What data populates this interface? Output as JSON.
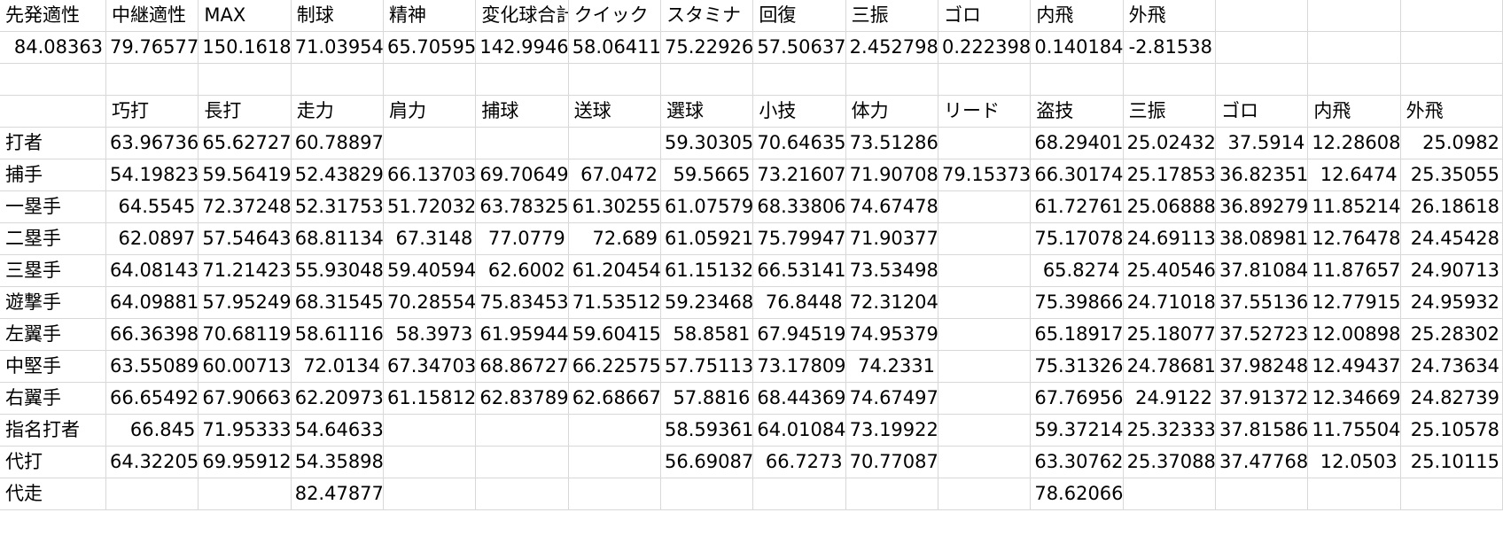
{
  "sheet": {
    "row1": [
      "先発適性",
      "中継適性",
      "MAX",
      "制球",
      "精神",
      "変化球合計",
      "クイック",
      "スタミナ",
      "回復",
      "三振",
      "ゴロ",
      "内飛",
      "外飛",
      "",
      "",
      ""
    ],
    "row2": [
      "84.08363",
      "79.76577",
      "150.1618",
      "71.03954",
      "65.70595",
      "142.9946",
      "58.06411",
      "75.22926",
      "57.50637",
      "2.452798",
      "0.222398",
      "0.140184",
      "-2.81538",
      "",
      "",
      ""
    ],
    "row3": [
      "",
      "",
      "",
      "",
      "",
      "",
      "",
      "",
      "",
      "",
      "",
      "",
      "",
      "",
      "",
      ""
    ],
    "row4": [
      "",
      "巧打",
      "長打",
      "走力",
      "肩力",
      "捕球",
      "送球",
      "選球",
      "小技",
      "体力",
      "リード",
      "盗技",
      "三振",
      "ゴロ",
      "内飛",
      "外飛"
    ],
    "rows": [
      [
        "打者",
        "63.96736",
        "65.62727",
        "60.78897",
        "",
        "",
        "",
        "59.30305",
        "70.64635",
        "73.51286",
        "",
        "68.29401",
        "25.02432",
        "37.5914",
        "12.28608",
        "25.0982"
      ],
      [
        "捕手",
        "54.19823",
        "59.56419",
        "52.43829",
        "66.13703",
        "69.70649",
        "67.0472",
        "59.5665",
        "73.21607",
        "71.90708",
        "79.15373",
        "66.30174",
        "25.17853",
        "36.82351",
        "12.6474",
        "25.35055"
      ],
      [
        "一塁手",
        "64.5545",
        "72.37248",
        "52.31753",
        "51.72032",
        "63.78325",
        "61.30255",
        "61.07579",
        "68.33806",
        "74.67478",
        "",
        "61.72761",
        "25.06888",
        "36.89279",
        "11.85214",
        "26.18618"
      ],
      [
        "二塁手",
        "62.0897",
        "57.54643",
        "68.81134",
        "67.3148",
        "77.0779",
        "72.689",
        "61.05921",
        "75.79947",
        "71.90377",
        "",
        "75.17078",
        "24.69113",
        "38.08981",
        "12.76478",
        "24.45428"
      ],
      [
        "三塁手",
        "64.08143",
        "71.21423",
        "55.93048",
        "59.40594",
        "62.6002",
        "61.20454",
        "61.15132",
        "66.53141",
        "73.53498",
        "",
        "65.8274",
        "25.40546",
        "37.81084",
        "11.87657",
        "24.90713"
      ],
      [
        "遊撃手",
        "64.09881",
        "57.95249",
        "68.31545",
        "70.28554",
        "75.83453",
        "71.53512",
        "59.23468",
        "76.8448",
        "72.31204",
        "",
        "75.39866",
        "24.71018",
        "37.55136",
        "12.77915",
        "24.95932"
      ],
      [
        "左翼手",
        "66.36398",
        "70.68119",
        "58.61116",
        "58.3973",
        "61.95944",
        "59.60415",
        "58.8581",
        "67.94519",
        "74.95379",
        "",
        "65.18917",
        "25.18077",
        "37.52723",
        "12.00898",
        "25.28302"
      ],
      [
        "中堅手",
        "63.55089",
        "60.00713",
        "72.0134",
        "67.34703",
        "68.86727",
        "66.22575",
        "57.75113",
        "73.17809",
        "74.2331",
        "",
        "75.31326",
        "24.78681",
        "37.98248",
        "12.49437",
        "24.73634"
      ],
      [
        "右翼手",
        "66.65492",
        "67.90663",
        "62.20973",
        "61.15812",
        "62.83789",
        "62.68667",
        "57.8816",
        "68.44369",
        "74.67497",
        "",
        "67.76956",
        "24.9122",
        "37.91372",
        "12.34669",
        "24.82739"
      ],
      [
        "指名打者",
        "66.845",
        "71.95333",
        "54.64633",
        "",
        "",
        "",
        "58.59361",
        "64.01084",
        "73.19922",
        "",
        "59.37214",
        "25.32333",
        "37.81586",
        "11.75504",
        "25.10578"
      ],
      [
        "代打",
        "64.32205",
        "69.95912",
        "54.35898",
        "",
        "",
        "",
        "56.69087",
        "66.7273",
        "70.77087",
        "",
        "63.30762",
        "25.37088",
        "37.47768",
        "12.0503",
        "25.10115"
      ],
      [
        "代走",
        "",
        "",
        "82.47877",
        "",
        "",
        "",
        "",
        "",
        "",
        "",
        "78.62066",
        "",
        "",
        "",
        ""
      ]
    ]
  }
}
